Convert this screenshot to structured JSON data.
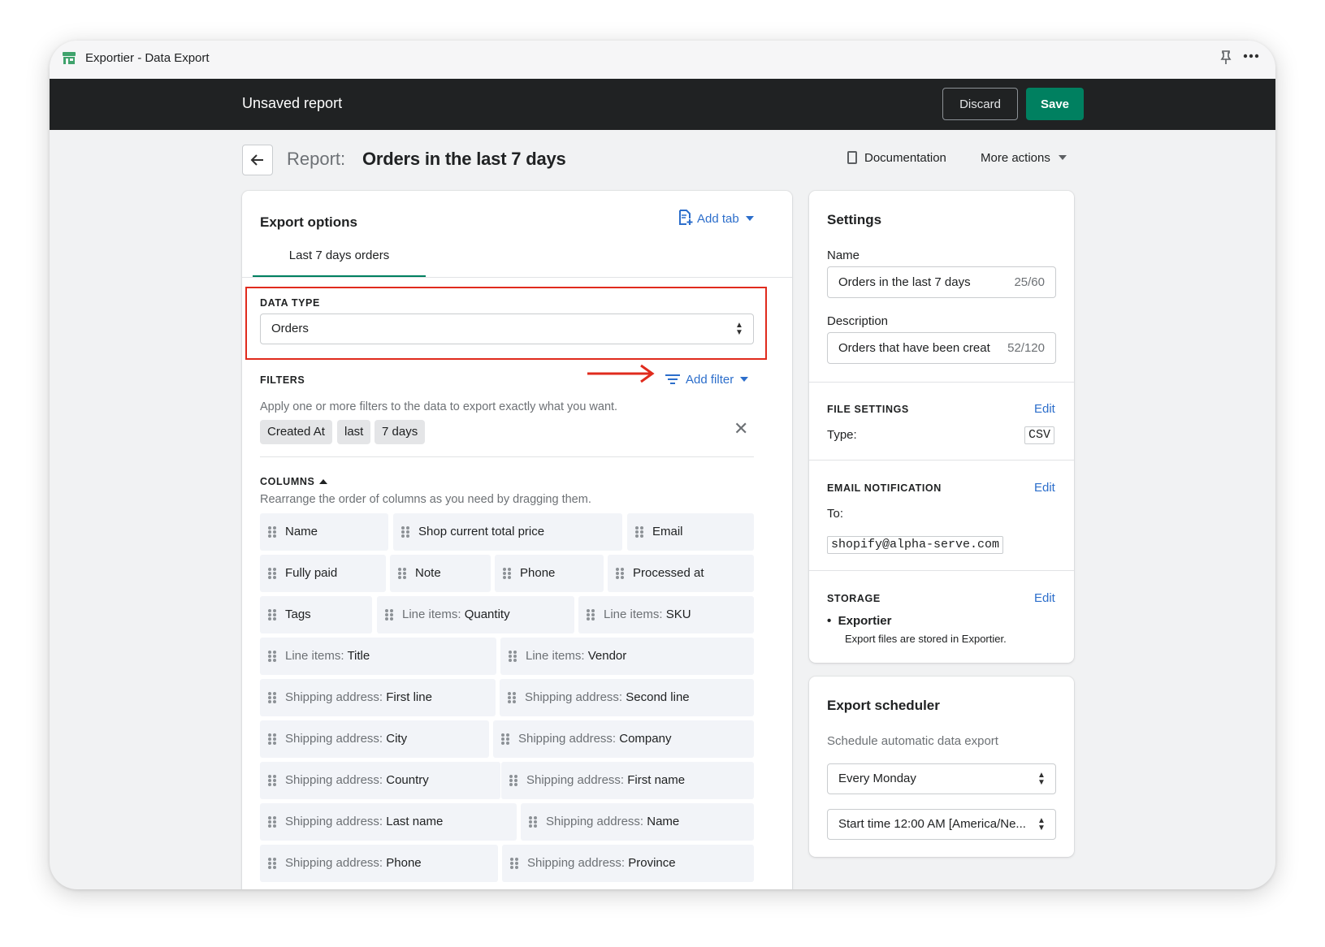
{
  "window": {
    "title": "Exportier - Data Export"
  },
  "topbar": {
    "title": "Unsaved report",
    "discard_label": "Discard",
    "save_label": "Save"
  },
  "header": {
    "report_label": "Report:",
    "report_title": "Orders in the last 7 days",
    "documentation_label": "Documentation",
    "more_actions_label": "More actions"
  },
  "export_options": {
    "title": "Export options",
    "add_tab_label": "Add tab",
    "tabs": [
      {
        "label": "Last 7 days orders",
        "active": true
      }
    ],
    "data_type": {
      "label": "DATA TYPE",
      "value": "Orders"
    },
    "filters": {
      "label": "FILTERS",
      "add_filter_label": "Add filter",
      "hint": "Apply one or more filters to the data to export exactly what you want.",
      "chips": [
        "Created At",
        "last",
        "7 days"
      ]
    },
    "columns": {
      "label": "COLUMNS",
      "hint": "Rearrange the order of columns as you need by dragging them.",
      "items": [
        {
          "prefix": "",
          "name": "Name"
        },
        {
          "prefix": "",
          "name": "Shop current total price"
        },
        {
          "prefix": "",
          "name": "Email"
        },
        {
          "prefix": "",
          "name": "Fully paid"
        },
        {
          "prefix": "",
          "name": "Note"
        },
        {
          "prefix": "",
          "name": "Phone"
        },
        {
          "prefix": "",
          "name": "Processed at"
        },
        {
          "prefix": "",
          "name": "Tags"
        },
        {
          "prefix": "Line items: ",
          "name": "Quantity"
        },
        {
          "prefix": "Line items: ",
          "name": "SKU"
        },
        {
          "prefix": "Line items: ",
          "name": "Title"
        },
        {
          "prefix": "Line items: ",
          "name": "Vendor"
        },
        {
          "prefix": "Shipping address: ",
          "name": "First line"
        },
        {
          "prefix": "Shipping address: ",
          "name": "Second line"
        },
        {
          "prefix": "Shipping address: ",
          "name": "City"
        },
        {
          "prefix": "Shipping address: ",
          "name": "Company"
        },
        {
          "prefix": "Shipping address: ",
          "name": "Country"
        },
        {
          "prefix": "Shipping address: ",
          "name": "First name"
        },
        {
          "prefix": "Shipping address: ",
          "name": "Last name"
        },
        {
          "prefix": "Shipping address: ",
          "name": "Name"
        },
        {
          "prefix": "Shipping address: ",
          "name": "Phone"
        },
        {
          "prefix": "Shipping address: ",
          "name": "Province"
        }
      ]
    }
  },
  "settings": {
    "title": "Settings",
    "name_label": "Name",
    "name_value": "Orders in the last 7 days",
    "name_counter": "25/60",
    "description_label": "Description",
    "description_value": "Orders that have been creat",
    "description_counter": "52/120",
    "file_settings": {
      "label": "FILE SETTINGS",
      "edit_label": "Edit",
      "type_label": "Type:",
      "type_value": "CSV"
    },
    "email_notification": {
      "label": "EMAIL NOTIFICATION",
      "edit_label": "Edit",
      "to_label": "To:",
      "to_value": "shopify@alpha-serve.com"
    },
    "storage": {
      "label": "STORAGE",
      "edit_label": "Edit",
      "name": "Exportier",
      "description": "Export files are stored in Exportier."
    }
  },
  "scheduler": {
    "title": "Export scheduler",
    "hint": "Schedule automatic data export",
    "frequency_value": "Every Monday",
    "start_time_value": "Start time 12:00 AM [America/Ne..."
  },
  "colors": {
    "brand_green": "#008060",
    "link_blue": "#2c6ecb",
    "highlight_red": "#e02b1d",
    "topbar": "#202223"
  }
}
